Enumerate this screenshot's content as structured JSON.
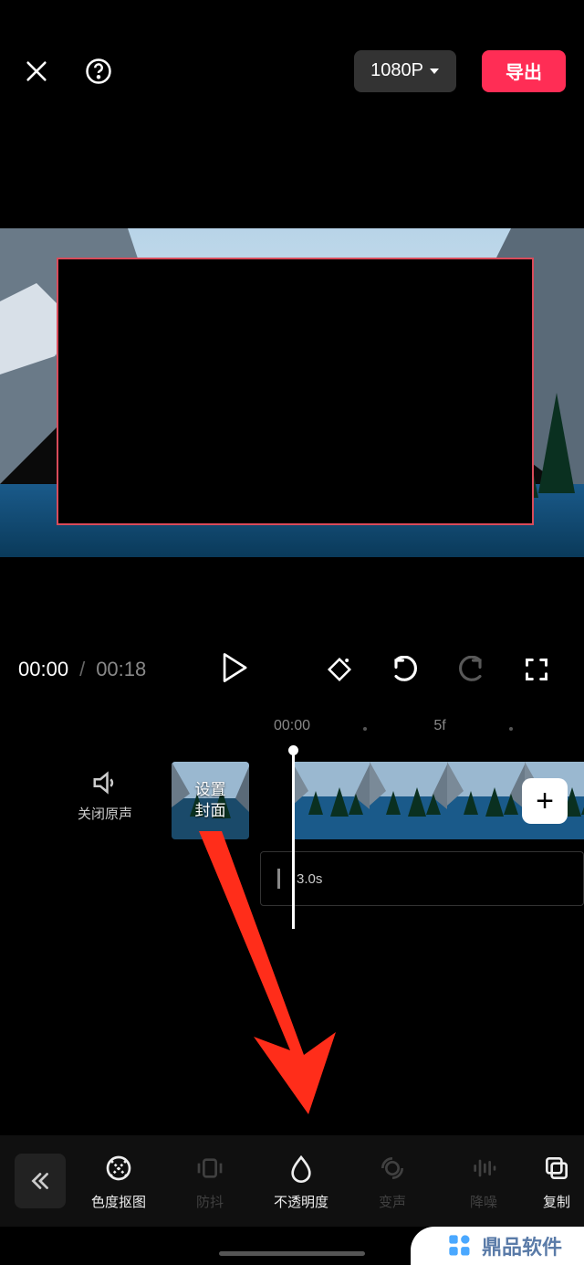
{
  "header": {
    "resolution": "1080P",
    "export": "导出"
  },
  "playback": {
    "current": "00:00",
    "separator": "/",
    "duration": "00:18"
  },
  "ruler": {
    "t0": "00:00",
    "t1": "5f"
  },
  "timeline": {
    "mute_label": "关闭原声",
    "cover_label": "设置\n封面",
    "add_label": "+",
    "sub_duration": "3.0s"
  },
  "tools": {
    "chroma": "色度抠图",
    "stabilize": "防抖",
    "opacity": "不透明度",
    "voice": "变声",
    "denoise": "降噪",
    "copy": "复制"
  },
  "watermark": {
    "text": "鼎品软件"
  }
}
